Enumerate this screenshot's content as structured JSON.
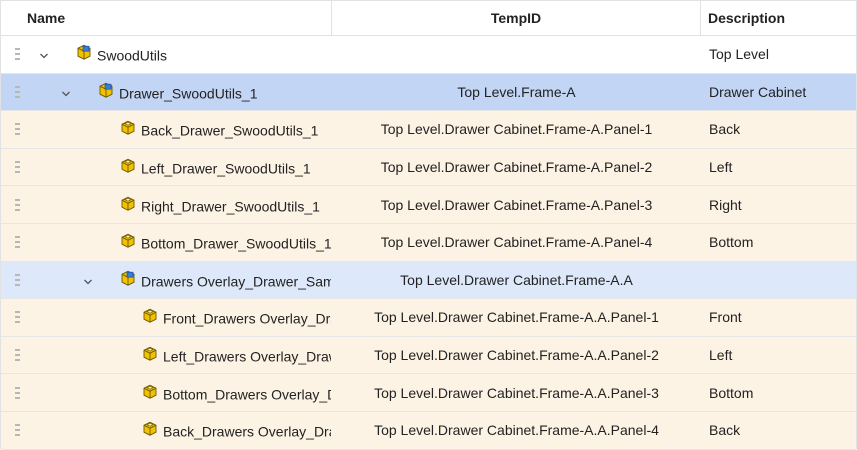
{
  "header": {
    "name": "Name",
    "tempid": "TempID",
    "description": "Description"
  },
  "colors": {
    "selected": "#c2d5f4",
    "child": "#fdf3e5",
    "subassembly": "#dde9fa",
    "part_icon": "#f2c200"
  },
  "rows": [
    {
      "name": "SwoodUtils",
      "tempid": "",
      "description": "Top Level",
      "icon": "assembly-icon",
      "expanded": true
    },
    {
      "name": "Drawer_SwoodUtils_1",
      "tempid": "Top Level.Frame-A",
      "description": "Drawer Cabinet",
      "icon": "assembly-icon",
      "expanded": true,
      "selected": true
    },
    {
      "name": "Back_Drawer_SwoodUtils_1",
      "tempid": "Top Level.Drawer Cabinet.Frame-A.Panel-1",
      "description": "Back",
      "icon": "part-icon"
    },
    {
      "name": "Left_Drawer_SwoodUtils_1",
      "tempid": "Top Level.Drawer Cabinet.Frame-A.Panel-2",
      "description": "Left",
      "icon": "part-icon"
    },
    {
      "name": "Right_Drawer_SwoodUtils_1",
      "tempid": "Top Level.Drawer Cabinet.Frame-A.Panel-3",
      "description": "Right",
      "icon": "part-icon"
    },
    {
      "name": "Bottom_Drawer_SwoodUtils_1",
      "tempid": "Top Level.Drawer Cabinet.Frame-A.Panel-4",
      "description": "Bottom",
      "icon": "part-icon"
    },
    {
      "name": "Drawers Overlay_Drawer_Samp",
      "tempid": "Top Level.Drawer Cabinet.Frame-A.A",
      "description": "",
      "icon": "assembly-icon",
      "expanded": true
    },
    {
      "name": "Front_Drawers Overlay_Dra",
      "tempid": "Top Level.Drawer Cabinet.Frame-A.A.Panel-1",
      "description": "Front",
      "icon": "part-icon"
    },
    {
      "name": "Left_Drawers Overlay_Draw",
      "tempid": "Top Level.Drawer Cabinet.Frame-A.A.Panel-2",
      "description": "Left",
      "icon": "part-icon"
    },
    {
      "name": "Bottom_Drawers Overlay_D",
      "tempid": "Top Level.Drawer Cabinet.Frame-A.A.Panel-3",
      "description": "Bottom",
      "icon": "part-icon"
    },
    {
      "name": "Back_Drawers Overlay_Drav",
      "tempid": "Top Level.Drawer Cabinet.Frame-A.A.Panel-4",
      "description": "Back",
      "icon": "part-icon"
    }
  ]
}
